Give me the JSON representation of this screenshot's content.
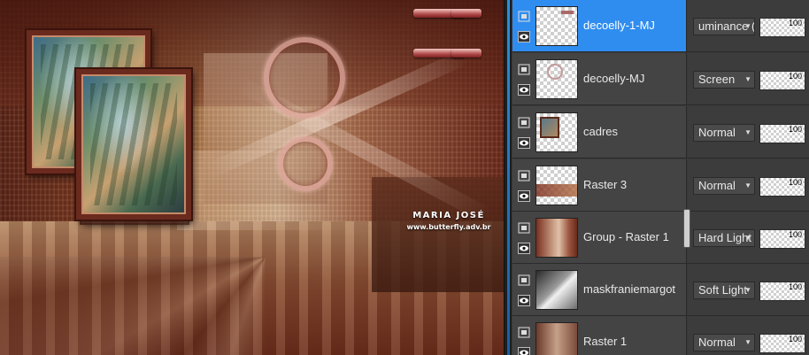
{
  "canvas": {
    "watermark_name": "MARIA JOSÉ",
    "watermark_url": "www.butterfly.adv.br"
  },
  "layers": [
    {
      "name": "decoelly-1-MJ",
      "blend": "uminance (",
      "opacity": "100",
      "selected": true,
      "thumb": "t-deco1"
    },
    {
      "name": "decoelly-MJ",
      "blend": "Screen",
      "opacity": "100",
      "selected": false,
      "thumb": "t-deco2"
    },
    {
      "name": "cadres",
      "blend": "Normal",
      "opacity": "100",
      "selected": false,
      "thumb": "t-cadres"
    },
    {
      "name": "Raster 3",
      "blend": "Normal",
      "opacity": "100",
      "selected": false,
      "thumb": "t-raster3"
    },
    {
      "name": "Group - Raster 1",
      "blend": "Hard Light",
      "opacity": "100",
      "selected": false,
      "thumb": "t-group"
    },
    {
      "name": "maskfraniemargot",
      "blend": "Soft Light",
      "opacity": "100",
      "selected": false,
      "thumb": "t-mask"
    },
    {
      "name": "Raster 1",
      "blend": "Normal",
      "opacity": "100",
      "selected": false,
      "thumb": "t-raster1"
    }
  ],
  "icons": {
    "visibility": "eye-icon",
    "lock": "layer-lock-icon",
    "dropdown": "chevron-down-icon"
  },
  "colors": {
    "selection": "#2f8df0",
    "panel_bg": "#3a3a3a"
  }
}
